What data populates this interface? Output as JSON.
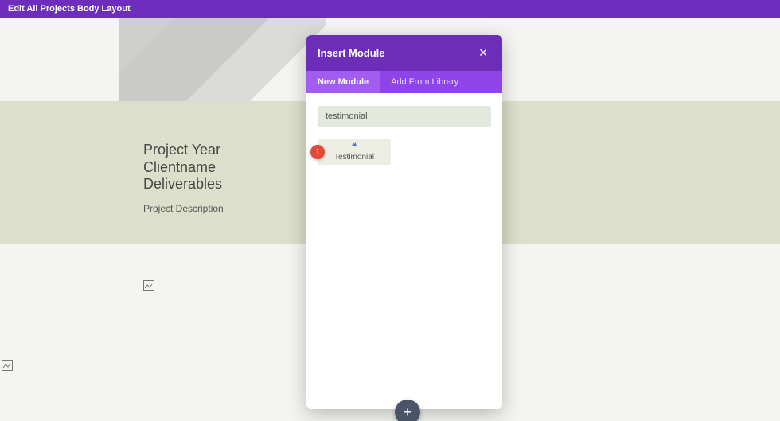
{
  "header": {
    "title": "Edit All Projects Body Layout"
  },
  "project": {
    "line1": "Project Year",
    "line2": "Clientname",
    "line3": "Deliverables",
    "description": "Project Description"
  },
  "modal": {
    "title": "Insert Module",
    "close": "✕",
    "tabs": {
      "new": "New Module",
      "library": "Add From Library"
    },
    "search_value": "testimonial",
    "module": {
      "badge": "1",
      "icon": "❝",
      "label": "Testimonial"
    }
  },
  "fab": {
    "glyph": "+"
  },
  "broken_img_glyph": "▫"
}
